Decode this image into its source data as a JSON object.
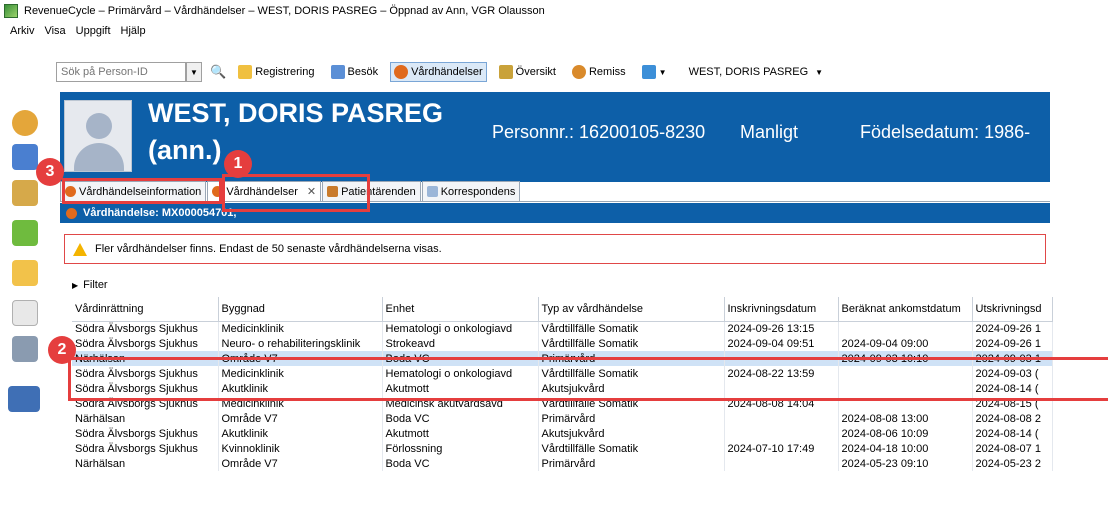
{
  "window": {
    "title": "RevenueCycle – Primärvård – Vårdhändelser – WEST, DORIS PASREG – Öppnad av Ann, VGR Olausson"
  },
  "menu": [
    "Arkiv",
    "Visa",
    "Uppgift",
    "Hjälp"
  ],
  "toolbar": {
    "search_placeholder": "Sök på Person-ID",
    "buttons": [
      "Registrering",
      "Besök",
      "Vårdhändelser",
      "Översikt",
      "Remiss"
    ],
    "patient_select": "WEST, DORIS PASREG"
  },
  "patient": {
    "name": "WEST, DORIS PASREG",
    "annotation": "(ann.)",
    "personnr": "Personnr.: 16200105-8230",
    "gender": "Manligt",
    "birth": "Födelsedatum: 1986-"
  },
  "tabs": [
    "Vårdhändelseinformation",
    "Vårdhändelser",
    "Patientärenden",
    "Korrespondens"
  ],
  "section": {
    "title": "Vårdhändelse: MX000054701,"
  },
  "warning": "Fler vårdhändelser finns. Endast de 50 senaste vårdhändelserna visas.",
  "filter_label": "Filter",
  "table": {
    "headers": [
      "Vårdinrättning",
      "Byggnad",
      "Enhet",
      "Typ av vårdhändelse",
      "Inskrivningsdatum",
      "Beräknat ankomstdatum",
      "Utskrivningsd"
    ],
    "rows": [
      [
        "Södra Älvsborgs Sjukhus",
        "Medicinklinik",
        "Hematologi o onkologiavd",
        "Vårdtillfälle Somatik",
        "2024-09-26 13:15",
        "",
        "2024-09-26 1"
      ],
      [
        "Södra Älvsborgs Sjukhus",
        "Neuro- o rehabiliteringsklinik",
        "Strokeavd",
        "Vårdtillfälle Somatik",
        "2024-09-04 09:51",
        "2024-09-04 09:00",
        "2024-09-26 1"
      ],
      [
        "Närhälsan",
        "Område V7",
        "Boda VC",
        "Primärvård",
        "",
        "2024-09-03 10:10",
        "2024-09-03 1"
      ],
      [
        "Södra Älvsborgs Sjukhus",
        "Medicinklinik",
        "Hematologi o onkologiavd",
        "Vårdtillfälle Somatik",
        "2024-08-22 13:59",
        "",
        "2024-09-03 ("
      ],
      [
        "Södra Älvsborgs Sjukhus",
        "Akutklinik",
        "Akutmott",
        "Akutsjukvård",
        "",
        "",
        "2024-08-14 ("
      ],
      [
        "Södra Älvsborgs Sjukhus",
        "Medicinklinik",
        "Medicinsk akutvårdsavd",
        "Vårdtillfälle Somatik",
        "2024-08-08 14:04",
        "",
        "2024-08-15 ("
      ],
      [
        "Närhälsan",
        "Område V7",
        "Boda VC",
        "Primärvård",
        "",
        "2024-08-08 13:00",
        "2024-08-08 2"
      ],
      [
        "Södra Älvsborgs Sjukhus",
        "Akutklinik",
        "Akutmott",
        "Akutsjukvård",
        "",
        "2024-08-06 10:09",
        "2024-08-14 ("
      ],
      [
        "Södra Älvsborgs Sjukhus",
        "Kvinnoklinik",
        "Förlossning",
        "Vårdtillfälle Somatik",
        "2024-07-10 17:49",
        "2024-04-18 10:00",
        "2024-08-07 1"
      ],
      [
        "Närhälsan",
        "Område V7",
        "Boda VC",
        "Primärvård",
        "",
        "2024-05-23 09:10",
        "2024-05-23 2"
      ]
    ]
  },
  "callouts": [
    "1",
    "2",
    "3"
  ],
  "colors": {
    "header_blue": "#0d5fa8",
    "highlight_red": "#e53e3e",
    "selected_row": "#cfe2f6"
  }
}
